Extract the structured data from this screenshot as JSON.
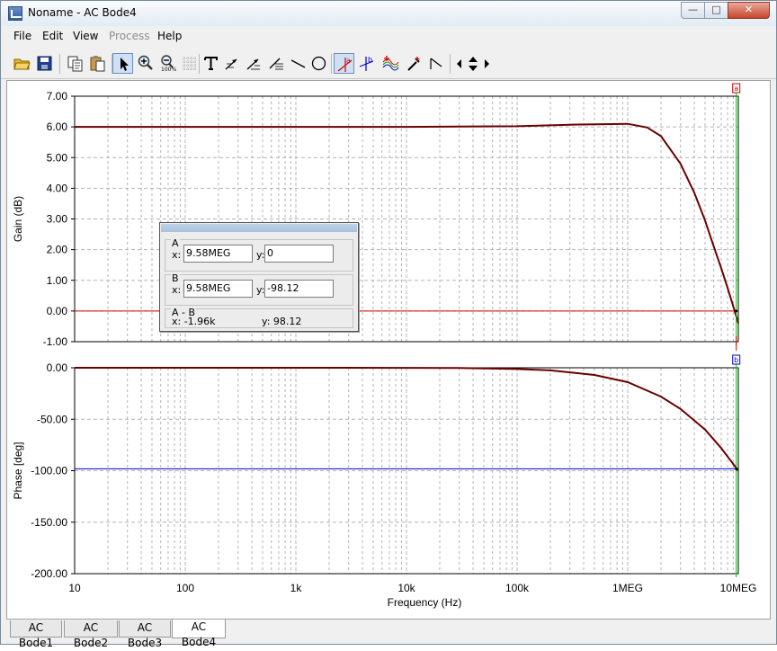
{
  "window": {
    "title": "Noname - AC Bode4",
    "min_glyph": "—",
    "max_glyph": "□",
    "close_glyph": "✕"
  },
  "menu": [
    "File",
    "Edit",
    "View",
    "Process",
    "Help"
  ],
  "toolbar": {
    "icons": [
      "open-icon",
      "save-icon",
      "copy-icon",
      "paste-icon",
      "pointer-icon",
      "zoom-in-icon",
      "zoom-out-icon",
      "grid-icon",
      "text-icon",
      "arrow-left-icon",
      "arrow-right-icon",
      "lines-icon",
      "line-icon",
      "circle-icon",
      "cursor-a-icon",
      "cursor-b-icon",
      "curves-icon",
      "marker-icon",
      "step-icon",
      "nav-left-icon",
      "nav-updown-icon",
      "nav-right-icon"
    ]
  },
  "cursor_dialog": {
    "group_a": {
      "label": "A",
      "x_label": "x:",
      "x_value": "9.58MEG",
      "y_label": "y:",
      "y_value": "0"
    },
    "group_b": {
      "label": "B",
      "x_label": "x:",
      "y_label": "y:",
      "x_value": "9.58MEG",
      "y_value": "-98.12"
    },
    "group_diff": {
      "label": "A - B",
      "x_text": "x:  -1.96k",
      "y_text": "y: 98.12"
    }
  },
  "tabs": [
    {
      "label": "AC Bode1",
      "active": false
    },
    {
      "label": "AC Bode2",
      "active": false
    },
    {
      "label": "AC Bode3",
      "active": false
    },
    {
      "label": "AC Bode4",
      "active": true
    }
  ],
  "colors": {
    "curve": "#6b0000",
    "cursor_a": "#d00000",
    "cursor_b": "#0000d0",
    "cursor_line": "#00c000",
    "grid": "#b4b4b4"
  },
  "chart_data": [
    {
      "type": "line",
      "ylabel": "Gain (dB)",
      "xscale": "log",
      "xlim": [
        10,
        10000000
      ],
      "ylim": [
        -1,
        7
      ],
      "yticks": [
        "7.00",
        "6.00",
        "5.00",
        "4.00",
        "3.00",
        "2.00",
        "1.00",
        "0.00",
        "-1.00"
      ],
      "cursor_marker": "a",
      "cursor_x": 9580000,
      "cursor_y": 0,
      "series": [
        {
          "x": [
            10,
            100,
            1000,
            10000,
            100000,
            300000,
            1000000,
            1500000,
            2000000,
            3000000,
            4000000,
            5000000,
            6000000,
            7000000,
            8000000,
            9000000,
            10000000
          ],
          "y": [
            6.0,
            6.0,
            6.0,
            6.0,
            6.02,
            6.07,
            6.1,
            5.98,
            5.7,
            4.8,
            3.85,
            2.95,
            2.1,
            1.4,
            0.75,
            0.15,
            -0.4
          ]
        }
      ]
    },
    {
      "type": "line",
      "ylabel": "Phase [deg]",
      "xlabel": "Frequency (Hz)",
      "xscale": "log",
      "xlim": [
        10,
        10000000
      ],
      "ylim": [
        -200,
        0
      ],
      "xticks": [
        "10",
        "100",
        "1k",
        "10k",
        "100k",
        "1MEG",
        "10MEG"
      ],
      "yticks": [
        "0.00",
        "-50.00",
        "-100.00",
        "-150.00",
        "-200.00"
      ],
      "cursor_marker": "b",
      "cursor_x": 9580000,
      "cursor_y": -98.12,
      "series": [
        {
          "x": [
            10,
            1000,
            10000,
            30000,
            100000,
            200000,
            500000,
            1000000,
            2000000,
            3000000,
            5000000,
            7000000,
            10000000
          ],
          "y": [
            0,
            0,
            -0.1,
            -0.3,
            -1.2,
            -2.5,
            -7,
            -14,
            -28,
            -40,
            -60,
            -78,
            -100
          ]
        }
      ]
    }
  ]
}
